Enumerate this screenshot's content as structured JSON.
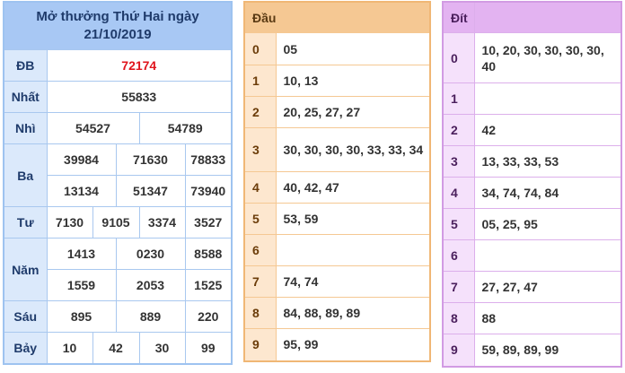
{
  "result": {
    "title": "Mở thưởng Thứ Hai ngày",
    "date": "21/10/2019",
    "db_label": "ĐB",
    "db": "72174",
    "nhat_label": "Nhất",
    "nhat": "55833",
    "nhi_label": "Nhì",
    "nhi": [
      "54527",
      "54789"
    ],
    "ba_label": "Ba",
    "ba": [
      "39984",
      "71630",
      "78833",
      "13134",
      "51347",
      "73940"
    ],
    "tu_label": "Tư",
    "tu": [
      "7130",
      "9105",
      "3374",
      "3527"
    ],
    "nam_label": "Năm",
    "nam": [
      "1413",
      "0230",
      "8588",
      "1559",
      "2053",
      "1525"
    ],
    "sau_label": "Sáu",
    "sau": [
      "895",
      "889",
      "220"
    ],
    "bay_label": "Bảy",
    "bay": [
      "10",
      "42",
      "30",
      "99"
    ]
  },
  "dau": {
    "header": "Đầu",
    "rows": [
      {
        "k": "0",
        "v": "05"
      },
      {
        "k": "1",
        "v": "10, 13"
      },
      {
        "k": "2",
        "v": "20, 25, 27, 27"
      },
      {
        "k": "3",
        "v": "30, 30, 30, 30, 33, 33, 34"
      },
      {
        "k": "4",
        "v": "40, 42, 47"
      },
      {
        "k": "5",
        "v": "53, 59"
      },
      {
        "k": "6",
        "v": ""
      },
      {
        "k": "7",
        "v": "74, 74"
      },
      {
        "k": "8",
        "v": "84, 88, 89, 89"
      },
      {
        "k": "9",
        "v": "95, 99"
      }
    ]
  },
  "dit": {
    "header": "Đít",
    "rows": [
      {
        "k": "0",
        "v": "10, 20, 30, 30, 30, 30, 40"
      },
      {
        "k": "1",
        "v": ""
      },
      {
        "k": "2",
        "v": "42"
      },
      {
        "k": "3",
        "v": "13, 33, 33, 53"
      },
      {
        "k": "4",
        "v": "34, 74, 74, 84"
      },
      {
        "k": "5",
        "v": "05, 25, 95"
      },
      {
        "k": "6",
        "v": ""
      },
      {
        "k": "7",
        "v": "27, 27, 47"
      },
      {
        "k": "8",
        "v": "88"
      },
      {
        "k": "9",
        "v": "59, 89, 89, 99"
      }
    ]
  }
}
